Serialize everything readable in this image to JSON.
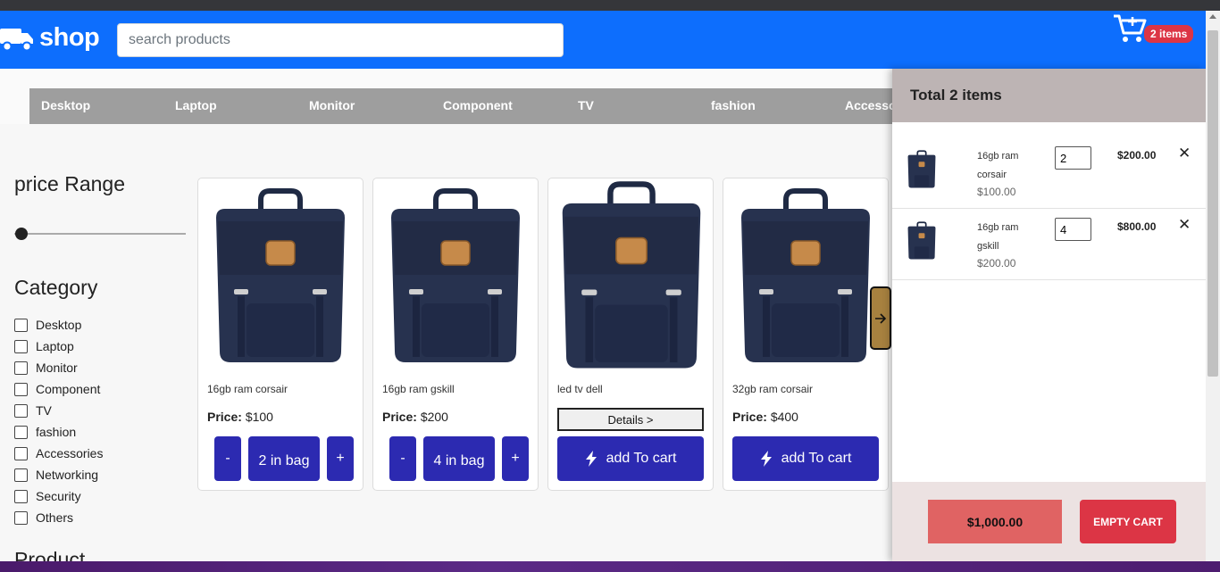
{
  "app": {
    "brand": "shop",
    "logo_icon": "truck-icon",
    "search_placeholder": "search products",
    "cart_badge": "2 items",
    "cart_icon": "cart-plus-icon"
  },
  "categories_bar": [
    "Desktop",
    "Laptop",
    "Monitor",
    "Component",
    "TV",
    "fashion",
    "Accessories"
  ],
  "sidebar": {
    "price_title": "price Range",
    "category_title": "Category",
    "categories": [
      "Desktop",
      "Laptop",
      "Monitor",
      "Component",
      "TV",
      "fashion",
      "Accessories",
      "Networking",
      "Security",
      "Others"
    ],
    "product_title": "Product"
  },
  "products": [
    {
      "name": "16gb ram corsair",
      "price_label": "Price:",
      "price": "$100",
      "in_bag": true,
      "minus": "-",
      "qty_label": "2 in bag",
      "plus": "+"
    },
    {
      "name": "16gb ram gskill",
      "price_label": "Price:",
      "price": "$200",
      "in_bag": true,
      "minus": "-",
      "qty_label": "4 in bag",
      "plus": "+"
    },
    {
      "name": "led tv dell",
      "details_label": "Details >",
      "add_label": "add To cart"
    },
    {
      "name": "32gb ram corsair",
      "price_label": "Price:",
      "price": "$400",
      "add_label": "add To cart"
    }
  ],
  "cart": {
    "title": "Total 2 items",
    "items": [
      {
        "name": "16gb ram corsair",
        "unit_price": "$100.00",
        "qty": "2",
        "total": "$200.00"
      },
      {
        "name": "16gb ram gskill",
        "unit_price": "$200.00",
        "qty": "4",
        "total": "$800.00"
      }
    ],
    "remove_icon": "close-icon",
    "grand_total": "$1,000.00",
    "empty_label": "EMPTY CART"
  },
  "colors": {
    "navbar": "#0d6efd",
    "primary_button": "#2c2ab1",
    "badge": "#dc3545",
    "grand_total_bg": "#e06363",
    "drawer_header": "#bdb4b4",
    "category_bar": "#9e9e9e"
  }
}
